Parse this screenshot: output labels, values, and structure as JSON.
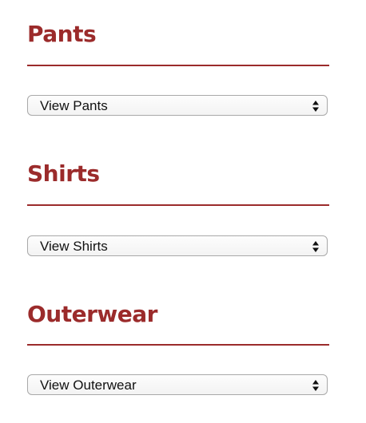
{
  "sections": [
    {
      "title": "Pants",
      "select_value": "View Pants",
      "arrows_icon": "select-arrows-icon"
    },
    {
      "title": "Shirts",
      "select_value": "View Shirts",
      "arrows_icon": "select-arrows-icon"
    },
    {
      "title": "Outerwear",
      "select_value": "View Outerwear",
      "arrows_icon": "select-arrows-icon"
    }
  ],
  "colors": {
    "heading": "#9b2b2b",
    "divider": "#9b2b2b",
    "select_border": "#a9a9a9",
    "select_text": "#111111"
  }
}
